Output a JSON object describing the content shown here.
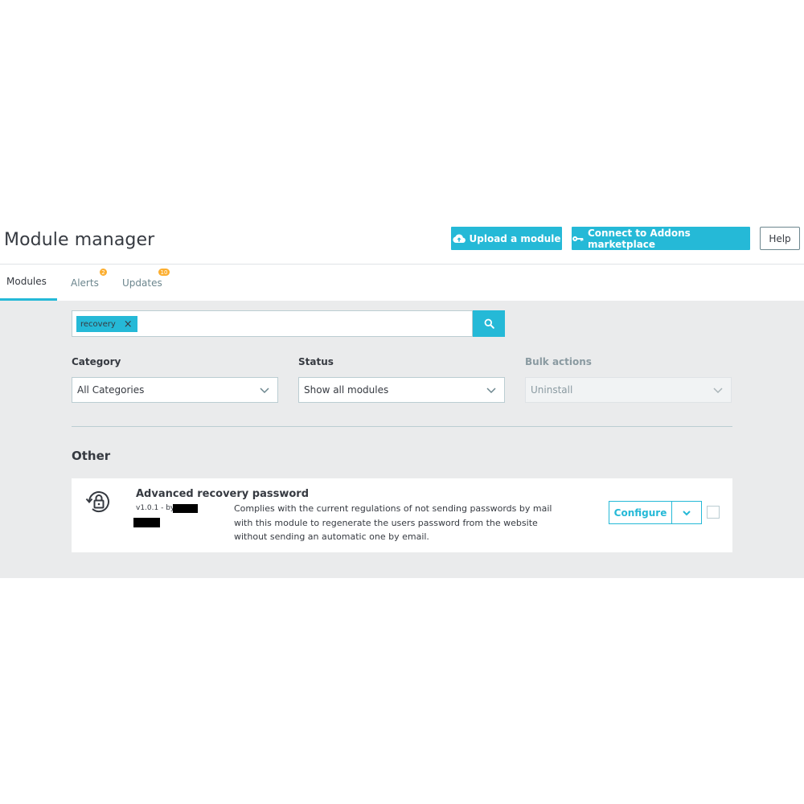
{
  "header": {
    "title": "Module manager",
    "upload_label": "Upload a module",
    "connect_label": "Connect to Addons marketplace",
    "help_label": "Help"
  },
  "tabs": [
    {
      "label": "Modules",
      "active": true
    },
    {
      "label": "Alerts",
      "badge": "2"
    },
    {
      "label": "Updates",
      "badge": "10"
    }
  ],
  "search": {
    "tag": "recovery",
    "tag_remove": "×"
  },
  "filters": {
    "category": {
      "label": "Category",
      "value": "All Categories"
    },
    "status": {
      "label": "Status",
      "value": "Show all modules"
    },
    "bulk": {
      "label": "Bulk actions",
      "value": "Uninstall"
    }
  },
  "section": {
    "title": "Other"
  },
  "module": {
    "name": "Advanced recovery password",
    "version": "v1.0.1 - by",
    "description": "Complies with the current regulations of not sending passwords by mail with this module to regenerate the users password from the website without sending an automatic one by email.",
    "configure_label": "Configure"
  },
  "colors": {
    "accent": "#25b9d7",
    "badge": "#fcae2f",
    "background": "#eaebec"
  }
}
